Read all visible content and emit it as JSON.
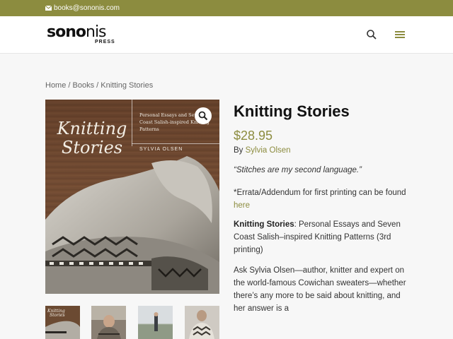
{
  "topbar": {
    "email": "books@sononis.com",
    "color": "#8c8c3f"
  },
  "header": {
    "logo_bold": "sono",
    "logo_light": "nis",
    "logo_press": "PRESS",
    "search_icon": "search-icon",
    "menu_icon": "hamburger-menu-icon"
  },
  "breadcrumb": {
    "home": "Home",
    "sep": " / ",
    "books": "Books",
    "current": "Knitting Stories"
  },
  "cover": {
    "title_line1": "Knitting",
    "title_line2": "Stories",
    "subtitle": "Personal Essays and Seven Coast Salish-inspired Knitting Patterns",
    "author": "SYLVIA OLSEN"
  },
  "product": {
    "title": "Knitting Stories",
    "price": "$28.95",
    "by_label": "By ",
    "author": "Sylvia Olsen",
    "quote": "“Stitches are my second language.”",
    "errata_text": "*Errata/Addendum for first printing can be found",
    "errata_link": "here",
    "desc_bold": "Knitting Stories",
    "desc_rest": ": Personal Essays and Seven Coast Salish–inspired Knitting Patterns (3rd printing)",
    "ask_text": "Ask Sylvia Olsen—author, knitter and expert on the world-famous Cowichan sweaters—whether there’s any more to be said about knitting, and her answer is a"
  },
  "accent_color": "#8c8c3f"
}
